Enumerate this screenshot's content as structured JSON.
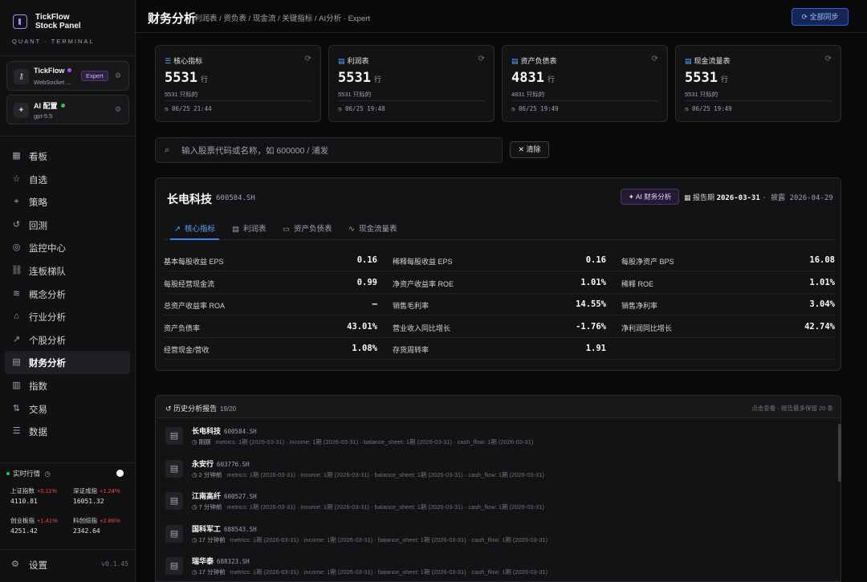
{
  "brand": {
    "title_line1": "TickFlow",
    "title_line2": "Stock Panel",
    "subtitle": "QUANT · TERMINAL"
  },
  "connections": [
    {
      "name": "TickFlow",
      "status": "WebSocket ...",
      "badge": "Expert",
      "dot_color": "#a855f7"
    },
    {
      "name": "AI 配置",
      "status": "gpt-5.5",
      "dot_color": "#22c55e"
    }
  ],
  "nav": [
    {
      "label": "看板",
      "icon": "dashboard-icon"
    },
    {
      "label": "自选",
      "icon": "star-icon"
    },
    {
      "label": "策略",
      "icon": "strategy-icon"
    },
    {
      "label": "回测",
      "icon": "history-icon"
    },
    {
      "label": "监控中心",
      "icon": "radar-icon"
    },
    {
      "label": "连板梯队",
      "icon": "ladder-icon"
    },
    {
      "label": "概念分析",
      "icon": "layers-icon"
    },
    {
      "label": "行业分析",
      "icon": "bank-icon"
    },
    {
      "label": "个股分析",
      "icon": "trend-icon"
    },
    {
      "label": "财务分析",
      "icon": "document-icon",
      "active": true
    },
    {
      "label": "指数",
      "icon": "bar-chart-icon"
    },
    {
      "label": "交易",
      "icon": "transfer-icon"
    },
    {
      "label": "数据",
      "icon": "database-icon"
    }
  ],
  "realtime": {
    "label": "实时行情",
    "indices": [
      {
        "name": "上证指数",
        "pct": "+0.11%",
        "value": "4110.81"
      },
      {
        "name": "深证成指",
        "pct": "+1.24%",
        "value": "16051.32"
      },
      {
        "name": "创业板指",
        "pct": "+1.41%",
        "value": "4251.42"
      },
      {
        "name": "科创综指",
        "pct": "+2.88%",
        "value": "2342.64"
      }
    ]
  },
  "settings": {
    "label": "设置",
    "version": "v0.1.45"
  },
  "header": {
    "title": "财务分析",
    "breadcrumb": "利润表 / 资负表 / 现金流 / 关键指标 / AI分析 · Expert",
    "sync_label": "全部同步"
  },
  "cards": [
    {
      "title": "核心指标",
      "value": "5531",
      "unit": "行",
      "sub": "5531 只标的",
      "time": "06/25 21:44"
    },
    {
      "title": "利润表",
      "value": "5531",
      "unit": "行",
      "sub": "5531 只标的",
      "time": "06/25 19:48"
    },
    {
      "title": "资产负债表",
      "value": "4831",
      "unit": "行",
      "sub": "4831 只标的",
      "time": "06/25 19:49"
    },
    {
      "title": "现金流量表",
      "value": "5531",
      "unit": "行",
      "sub": "5531 只标的",
      "time": "06/25 19:49"
    }
  ],
  "search": {
    "placeholder": "输入股票代码或名称，如 600000 / 浦发",
    "clear_label": "清除"
  },
  "stock": {
    "name": "长电科技",
    "code": "600584.SH",
    "ai_label": "AI 财务分析",
    "period_label": "报告期",
    "period": "2026-03-31",
    "disclosure": "· 披露 2026-04-29"
  },
  "tabs": [
    "核心指标",
    "利润表",
    "资产负债表",
    "现金流量表"
  ],
  "metrics": [
    [
      {
        "label": "基本每股收益 EPS",
        "value": "0.16"
      },
      {
        "label": "稀释每股收益 EPS",
        "value": "0.16"
      },
      {
        "label": "每股净资产 BPS",
        "value": "16.08"
      }
    ],
    [
      {
        "label": "每股经营现金流",
        "value": "0.99"
      },
      {
        "label": "净资产收益率 ROE",
        "value": "1.01%"
      },
      {
        "label": "稀释 ROE",
        "value": "1.01%"
      }
    ],
    [
      {
        "label": "总资产收益率 ROA",
        "value": "—"
      },
      {
        "label": "销售毛利率",
        "value": "14.55%"
      },
      {
        "label": "销售净利率",
        "value": "3.04%"
      }
    ],
    [
      {
        "label": "资产负债率",
        "value": "43.01%"
      },
      {
        "label": "营业收入同比增长",
        "value": "-1.76%"
      },
      {
        "label": "净利润同比增长",
        "value": "42.74%"
      }
    ],
    [
      {
        "label": "经营现金/营收",
        "value": "1.08%"
      },
      {
        "label": "存货周转率",
        "value": "1.91"
      }
    ]
  ],
  "history": {
    "title": "历史分析报告",
    "count": "19/20",
    "hint": "点击查看 · 报告最多保留 20 条",
    "items": [
      {
        "name": "长电科技",
        "code": "600584.SH",
        "time": "刚刚",
        "detail": "metrics: 1期 (2026-03-31) · income: 1期 (2026-03-31) · balance_sheet: 1期 (2026-03-31) · cash_flow: 1期 (2026-03-31)"
      },
      {
        "name": "永安行",
        "code": "603776.SH",
        "time": "2 分钟前",
        "detail": "metrics: 1期 (2026-03-31) · income: 1期 (2026-03-31) · balance_sheet: 1期 (2026-03-31) · cash_flow: 1期 (2026-03-31)"
      },
      {
        "name": "江南高纤",
        "code": "600527.SH",
        "time": "7 分钟前",
        "detail": "metrics: 1期 (2026-03-31) · income: 1期 (2026-03-31) · balance_sheet: 1期 (2026-03-31) · cash_flow: 1期 (2026-03-31)"
      },
      {
        "name": "国科军工",
        "code": "688543.SH",
        "time": "17 分钟前",
        "detail": "metrics: 1期 (2026-03-31) · income: 1期 (2026-03-31) · balance_sheet: 1期 (2026-03-31) · cash_flow: 1期 (2026-03-31)"
      },
      {
        "name": "瑞华泰",
        "code": "688323.SH",
        "time": "17 分钟前",
        "detail": "metrics: 1期 (2026-03-31) · income: 1期 (2026-03-31) · balance_sheet: 1期 (2026-03-31) · cash_flow: 1期 (2026-03-31)"
      }
    ]
  }
}
